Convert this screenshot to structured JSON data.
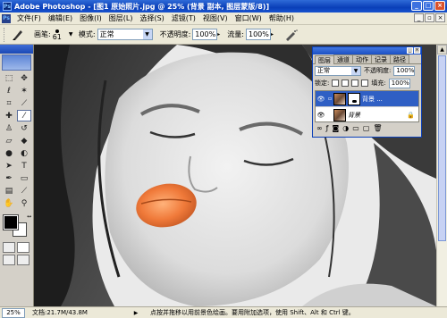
{
  "window": {
    "title": "Adobe Photoshop - [图1 原始照片.jpg @ 25% (背景 副本, 图层蒙版/8)]",
    "app_icon": "Ps",
    "controls": [
      "minimize-icon",
      "maximize-icon",
      "close-icon"
    ]
  },
  "menu": {
    "items": [
      "文件(F)",
      "编辑(E)",
      "图像(I)",
      "图层(L)",
      "选择(S)",
      "滤镜(T)",
      "视图(V)",
      "窗口(W)",
      "帮助(H)"
    ]
  },
  "options": {
    "brush_label": "画笔:",
    "brush_size": "61",
    "mode_label": "模式:",
    "mode_value": "正常",
    "opacity_label": "不透明度:",
    "opacity_value": "100%",
    "flow_label": "流量:",
    "flow_value": "100%"
  },
  "layers_panel": {
    "tabs": [
      "图层",
      "通道",
      "动作",
      "记录",
      "路径"
    ],
    "blend_mode": "正常",
    "opacity_label": "不透明度:",
    "opacity_value": "100%",
    "lock_label": "锁定:",
    "fill_label": "填充:",
    "fill_value": "100%",
    "layers": [
      {
        "name": "背景 ...",
        "selected": true
      },
      {
        "name": "背景",
        "selected": false
      }
    ]
  },
  "status": {
    "zoom": "25%",
    "doc_size": "文档:21.7M/43.8M",
    "hint": "点按并拖移以用前景色绘画。要用附加选项，使用 Shift、Alt 和 Ctrl 键。"
  },
  "colors": {
    "foreground": "#000000",
    "background": "#ffffff",
    "title_blue": "#0a3fb8"
  }
}
